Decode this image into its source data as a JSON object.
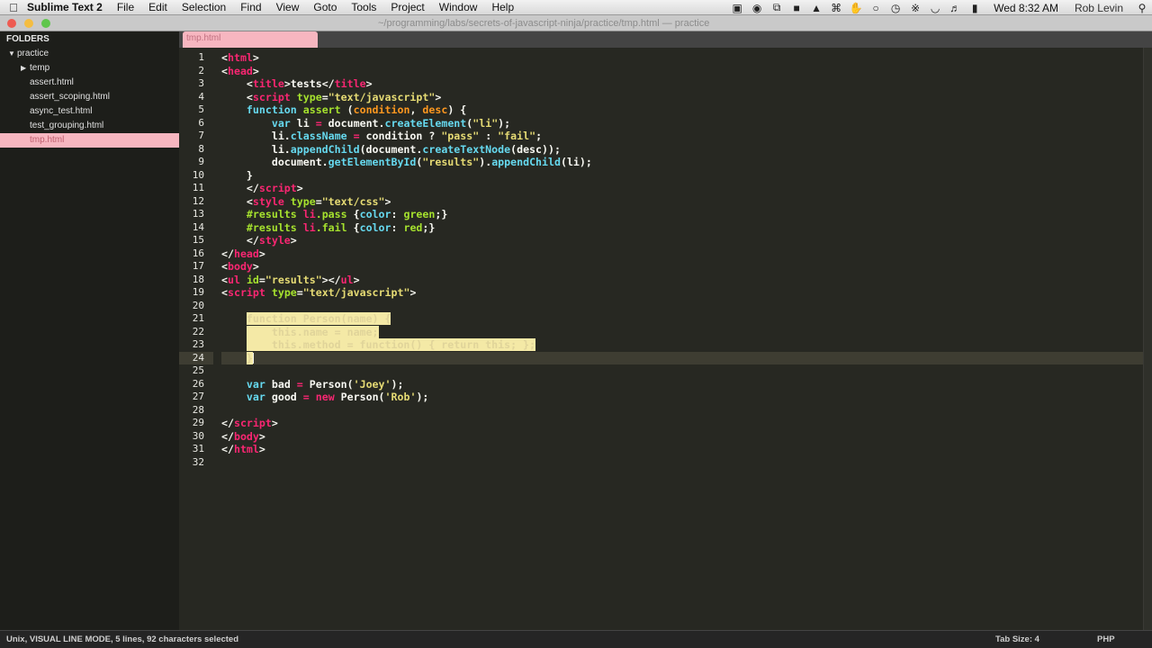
{
  "menubar": {
    "app_name": "Sublime Text 2",
    "items": [
      "File",
      "Edit",
      "Selection",
      "Find",
      "View",
      "Goto",
      "Tools",
      "Project",
      "Window",
      "Help"
    ],
    "clock": "Wed 8:32 AM",
    "user": "Rob Levin"
  },
  "titlebar": {
    "title": "~/programming/labs/secrets-of-javascript-ninja/practice/tmp.html — practice"
  },
  "sidebar": {
    "header": "FOLDERS",
    "root": "practice",
    "subfolder": "temp",
    "files": [
      "assert.html",
      "assert_scoping.html",
      "async_test.html",
      "test_grouping.html",
      "tmp.html"
    ],
    "selected_file": "tmp.html"
  },
  "tab": {
    "label": "tmp.html"
  },
  "editor": {
    "current_line": 24,
    "selection_lines": [
      21,
      22,
      23,
      24
    ],
    "lines": [
      [
        [
          "<",
          ""
        ],
        [
          "html",
          "t-tag"
        ],
        [
          ">",
          ""
        ]
      ],
      [
        [
          "<",
          ""
        ],
        [
          "head",
          "t-tag"
        ],
        [
          ">",
          ""
        ]
      ],
      [
        [
          "    <",
          ""
        ],
        [
          "title",
          "t-tag"
        ],
        [
          ">tests</",
          ""
        ],
        [
          "title",
          "t-tag"
        ],
        [
          ">",
          ""
        ]
      ],
      [
        [
          "    <",
          ""
        ],
        [
          "script",
          "t-tag"
        ],
        [
          " ",
          ""
        ],
        [
          "type",
          "t-fn"
        ],
        [
          "=",
          ""
        ],
        [
          "\"text/javascript\"",
          "t-str"
        ],
        [
          ">",
          ""
        ]
      ],
      [
        [
          "    ",
          ""
        ],
        [
          "function",
          "t-kw"
        ],
        [
          " ",
          ""
        ],
        [
          "assert",
          "t-fn"
        ],
        [
          " (",
          ""
        ],
        [
          "condition",
          "t-arg"
        ],
        [
          ", ",
          ""
        ],
        [
          "desc",
          "t-arg"
        ],
        [
          ") {",
          ""
        ]
      ],
      [
        [
          "        ",
          ""
        ],
        [
          "var",
          "t-kw"
        ],
        [
          " li ",
          ""
        ],
        [
          "=",
          "t-op"
        ],
        [
          " document.",
          ""
        ],
        [
          "createElement",
          "t-kw"
        ],
        [
          "(",
          ""
        ],
        [
          "\"li\"",
          "t-str"
        ],
        [
          ");",
          ""
        ]
      ],
      [
        [
          "        li.",
          ""
        ],
        [
          "className",
          "t-kw"
        ],
        [
          " ",
          ""
        ],
        [
          "=",
          "t-op"
        ],
        [
          " condition ? ",
          ""
        ],
        [
          "\"pass\"",
          "t-str"
        ],
        [
          " : ",
          ""
        ],
        [
          "\"fail\"",
          "t-str"
        ],
        [
          ";",
          ""
        ]
      ],
      [
        [
          "        li.",
          ""
        ],
        [
          "appendChild",
          "t-kw"
        ],
        [
          "(document.",
          ""
        ],
        [
          "createTextNode",
          "t-kw"
        ],
        [
          "(desc));",
          ""
        ]
      ],
      [
        [
          "        document.",
          ""
        ],
        [
          "getElementById",
          "t-kw"
        ],
        [
          "(",
          ""
        ],
        [
          "\"results\"",
          "t-str"
        ],
        [
          ").",
          ""
        ],
        [
          "appendChild",
          "t-kw"
        ],
        [
          "(li);",
          ""
        ]
      ],
      [
        [
          "    }",
          ""
        ]
      ],
      [
        [
          "    </",
          ""
        ],
        [
          "script",
          "t-tag"
        ],
        [
          ">",
          ""
        ]
      ],
      [
        [
          "    <",
          ""
        ],
        [
          "style",
          "t-tag"
        ],
        [
          " ",
          ""
        ],
        [
          "type",
          "t-fn"
        ],
        [
          "=",
          ""
        ],
        [
          "\"text/css\"",
          "t-str"
        ],
        [
          ">",
          ""
        ]
      ],
      [
        [
          "    ",
          ""
        ],
        [
          "#results",
          "t-fn"
        ],
        [
          " ",
          ""
        ],
        [
          "li",
          "t-tag"
        ],
        [
          ".pass",
          "t-fn"
        ],
        [
          " {",
          ""
        ],
        [
          "color",
          "t-kw"
        ],
        [
          ": ",
          ""
        ],
        [
          "green",
          "t-fn"
        ],
        [
          ";}",
          ""
        ]
      ],
      [
        [
          "    ",
          ""
        ],
        [
          "#results",
          "t-fn"
        ],
        [
          " ",
          ""
        ],
        [
          "li",
          "t-tag"
        ],
        [
          ".fail",
          "t-fn"
        ],
        [
          " {",
          ""
        ],
        [
          "color",
          "t-kw"
        ],
        [
          ": ",
          ""
        ],
        [
          "red",
          "t-fn"
        ],
        [
          ";}",
          ""
        ]
      ],
      [
        [
          "    </",
          ""
        ],
        [
          "style",
          "t-tag"
        ],
        [
          ">",
          ""
        ]
      ],
      [
        [
          "</",
          ""
        ],
        [
          "head",
          "t-tag"
        ],
        [
          ">",
          ""
        ]
      ],
      [
        [
          "<",
          ""
        ],
        [
          "body",
          "t-tag"
        ],
        [
          ">",
          ""
        ]
      ],
      [
        [
          "<",
          ""
        ],
        [
          "ul",
          "t-tag"
        ],
        [
          " ",
          ""
        ],
        [
          "id",
          "t-fn"
        ],
        [
          "=",
          ""
        ],
        [
          "\"results\"",
          "t-str"
        ],
        [
          "></",
          ""
        ],
        [
          "ul",
          "t-tag"
        ],
        [
          ">",
          ""
        ]
      ],
      [
        [
          "<",
          ""
        ],
        [
          "script",
          "t-tag"
        ],
        [
          " ",
          ""
        ],
        [
          "type",
          "t-fn"
        ],
        [
          "=",
          ""
        ],
        [
          "\"text/javascript\"",
          "t-str"
        ],
        [
          ">",
          ""
        ]
      ],
      [],
      [
        [
          "    ",
          ""
        ],
        [
          "function Person(name) {",
          "sel"
        ]
      ],
      [
        [
          "    ",
          ""
        ],
        [
          "    this.name = name;",
          "sel"
        ]
      ],
      [
        [
          "    ",
          ""
        ],
        [
          "    this.method = function() { return this; };",
          "sel"
        ]
      ],
      [
        [
          "    ",
          ""
        ],
        [
          "}",
          "sel"
        ]
      ],
      [],
      [
        [
          "    ",
          ""
        ],
        [
          "var",
          "t-kw"
        ],
        [
          " bad ",
          ""
        ],
        [
          "=",
          "t-op"
        ],
        [
          " Person(",
          ""
        ],
        [
          "'Joey'",
          "t-str"
        ],
        [
          ");",
          ""
        ]
      ],
      [
        [
          "    ",
          ""
        ],
        [
          "var",
          "t-kw"
        ],
        [
          " good ",
          ""
        ],
        [
          "=",
          "t-op"
        ],
        [
          " ",
          ""
        ],
        [
          "new",
          "t-op"
        ],
        [
          " Person(",
          ""
        ],
        [
          "'Rob'",
          "t-str"
        ],
        [
          ");",
          ""
        ]
      ],
      [],
      [
        [
          "</",
          ""
        ],
        [
          "script",
          "t-tag"
        ],
        [
          ">",
          ""
        ]
      ],
      [
        [
          "</",
          ""
        ],
        [
          "body",
          "t-tag"
        ],
        [
          ">",
          ""
        ]
      ],
      [
        [
          "</",
          ""
        ],
        [
          "html",
          "t-tag"
        ],
        [
          ">",
          ""
        ]
      ],
      []
    ]
  },
  "statusbar": {
    "left": "Unix, VISUAL LINE MODE, 5 lines, 92 characters selected",
    "tab_size": "Tab Size: 4",
    "syntax": "PHP"
  }
}
